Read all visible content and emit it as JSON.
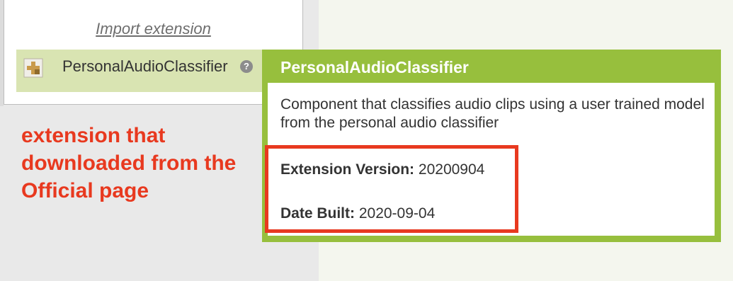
{
  "palette": {
    "import_label": "Import extension",
    "extension": {
      "name": "PersonalAudioClassifier",
      "help_glyph": "?"
    }
  },
  "annotation": {
    "text": "extension that downloaded from the Official page",
    "color": "#e8391f"
  },
  "popup": {
    "title": "PersonalAudioClassifier",
    "description": "Component that classifies audio clips using a user trained model from the personal audio classifier",
    "version_label": "Extension Version:",
    "version_value": "20200904",
    "date_label": "Date Built:",
    "date_value": "2020-09-04",
    "accent_color": "#97bf3d"
  }
}
